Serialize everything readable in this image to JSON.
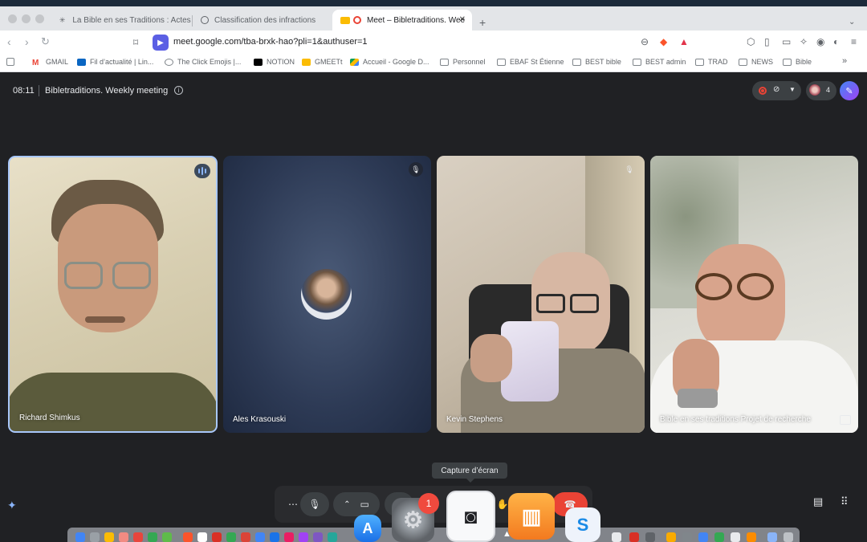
{
  "browser": {
    "tabs": [
      {
        "title": "La Bible en ses Traditions : Actes d",
        "active": false
      },
      {
        "title": "Classification des infractions",
        "active": false
      },
      {
        "title": "Meet – Bibletraditions. Wee",
        "active": true
      }
    ],
    "url": "meet.google.com/tba-brxk-hao?pli=1&authuser=1",
    "bookmarks": [
      {
        "label": "GMAIL",
        "icon": "gmail-icon"
      },
      {
        "label": "Fil d’actualité | Lin...",
        "icon": "linkedin-icon"
      },
      {
        "label": "The Click Emojis |...",
        "icon": "globe-icon"
      },
      {
        "label": "NOTION",
        "icon": "notion-icon"
      },
      {
        "label": "GMEETt",
        "icon": "meet-icon"
      },
      {
        "label": "Accueil - Google D...",
        "icon": "drive-icon"
      },
      {
        "label": "Personnel",
        "icon": "folder-icon"
      },
      {
        "label": "EBAF St Étienne",
        "icon": "folder-icon"
      },
      {
        "label": "BEST bible",
        "icon": "folder-icon"
      },
      {
        "label": "BEST admin",
        "icon": "folder-icon"
      },
      {
        "label": "TRAD",
        "icon": "folder-icon"
      },
      {
        "label": "NEWS",
        "icon": "folder-icon"
      },
      {
        "label": "Bible",
        "icon": "folder-icon"
      }
    ]
  },
  "meeting": {
    "time": "08:11",
    "title": "Bibletraditions. Weekly meeting",
    "participant_count": "4",
    "participants": [
      {
        "name": "Richard Shimkus",
        "status": "speaking"
      },
      {
        "name": "Ales Krasouski",
        "status": "muted"
      },
      {
        "name": "Kevin Stephens",
        "status": "muted"
      },
      {
        "name": "Bible en ses traditions Projet de recherche",
        "status": "presenting"
      }
    ]
  },
  "tooltip": "Capture d’écran",
  "dock": {
    "settings_badge": "1"
  },
  "colors": {
    "meet_bg": "#202124",
    "active_tile_border": "#a8c7fa",
    "hangup_red": "#ea4335",
    "meet_accent": "#5b5fe4"
  }
}
